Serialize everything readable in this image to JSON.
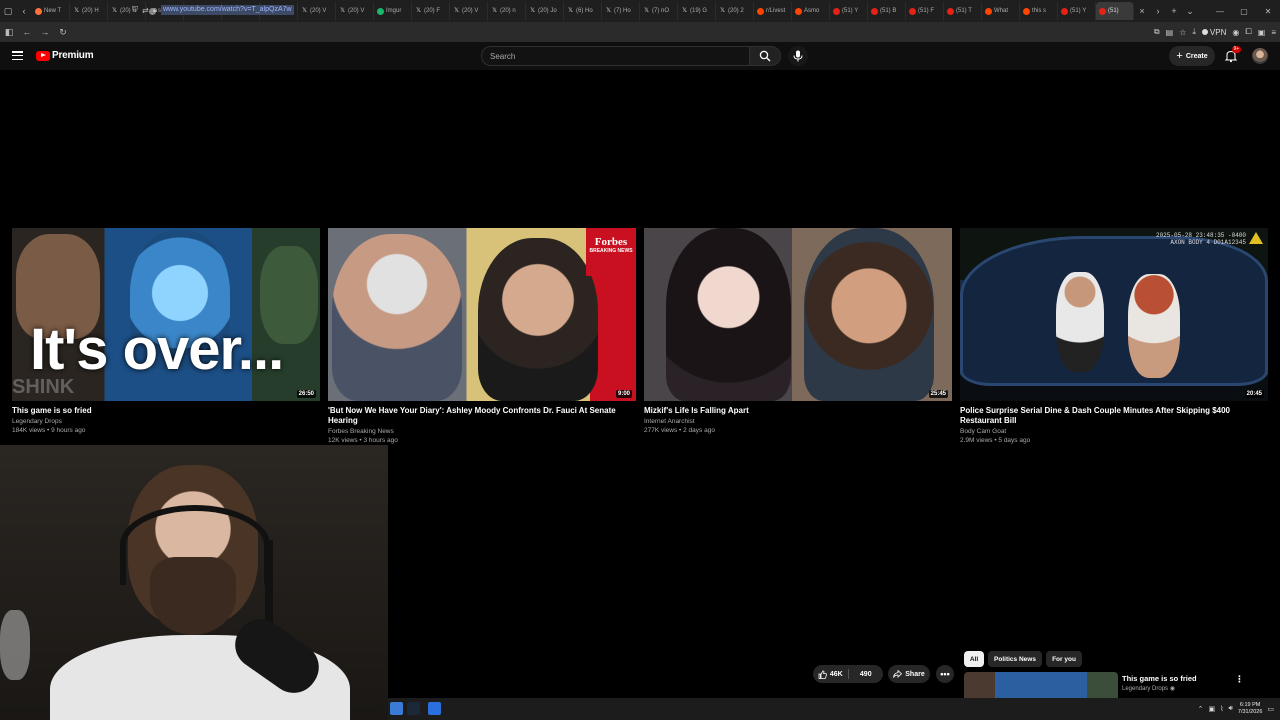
{
  "browser": {
    "tabs": [
      {
        "label": "New T",
        "icon": "firefox-icon"
      },
      {
        "label": "(20) H",
        "icon": "x-icon"
      },
      {
        "label": "(20) R",
        "icon": "x-icon"
      },
      {
        "label": "space",
        "icon": "globe-icon"
      },
      {
        "label": "Imgur",
        "icon": "imgur-icon"
      },
      {
        "label": "(7) Ho",
        "icon": "x-icon"
      },
      {
        "label": "(9) Ho",
        "icon": "x-icon"
      },
      {
        "label": "(20) V",
        "icon": "x-icon"
      },
      {
        "label": "(20) V",
        "icon": "x-icon"
      },
      {
        "label": "Imgur",
        "icon": "imgur-icon"
      },
      {
        "label": "(20) F",
        "icon": "x-icon"
      },
      {
        "label": "(20) V",
        "icon": "x-icon"
      },
      {
        "label": "(20) n",
        "icon": "x-icon"
      },
      {
        "label": "(20) Jo",
        "icon": "x-icon"
      },
      {
        "label": "(6) Ho",
        "icon": "x-icon"
      },
      {
        "label": "(7) Ho",
        "icon": "x-icon"
      },
      {
        "label": "(7) nO",
        "icon": "x-icon"
      },
      {
        "label": "(19) G",
        "icon": "x-icon"
      },
      {
        "label": "(20) 2",
        "icon": "x-icon"
      },
      {
        "label": "r/Livest",
        "icon": "reddit-icon"
      },
      {
        "label": "Asmo",
        "icon": "reddit-icon"
      },
      {
        "label": "(51) Y",
        "icon": "youtube-icon"
      },
      {
        "label": "(51) B",
        "icon": "youtube-icon"
      },
      {
        "label": "(51) F",
        "icon": "youtube-icon"
      },
      {
        "label": "(51) T",
        "icon": "youtube-icon"
      },
      {
        "label": "What",
        "icon": "reddit-icon"
      },
      {
        "label": "this s",
        "icon": "reddit-icon"
      },
      {
        "label": "(51) Y",
        "icon": "youtube-icon"
      },
      {
        "label": "(51)",
        "icon": "youtube-icon",
        "active": true
      }
    ],
    "url": "www.youtube.com/watch?v=T_alpQzA7w",
    "vpn_label": "VPN"
  },
  "youtube": {
    "logo_text": "Premium",
    "search_placeholder": "Search",
    "create_label": "Create",
    "notif_count": "9+"
  },
  "videos": [
    {
      "title": "This game is so fried",
      "channel": "Legendary Drops",
      "meta": "184K views • 9 hours ago",
      "duration": "26:50",
      "overlay": "It's over...",
      "watermark": "SHINK"
    },
    {
      "title": "'But Now We Have Your Diary': Ashley Moody Confronts Dr. Fauci At Senate Hearing",
      "channel": "Forbes Breaking News",
      "meta": "12K views • 3 hours ago",
      "duration": "9:00",
      "badge_top": "Forbes",
      "badge_bottom": "BREAKING NEWS"
    },
    {
      "title": "Mizkif's Life Is Falling Apart",
      "channel": "Internet Anarchist",
      "meta": "277K views • 2 days ago",
      "duration": "25:45"
    },
    {
      "title": "Police Surprise Serial Dine & Dash Couple Minutes After Skipping $400 Restaurant Bill",
      "channel": "Body Cam Goat",
      "meta": "2.9M views • 5 days ago",
      "duration": "20:45",
      "stamp_line1": "2025-05-28 23:48:35 -0400",
      "stamp_line2": "AXON BODY 4 D01A12345"
    }
  ],
  "actions": {
    "likes": "46K",
    "comments": "490",
    "share": "Share",
    "more": "•••"
  },
  "chips": [
    "All",
    "Politics News",
    "For you"
  ],
  "up_next": {
    "title": "This game is so fried",
    "channel": "Legendary Drops"
  },
  "taskbar": {
    "time": "6:19 PM",
    "date": "7/31/2026"
  }
}
